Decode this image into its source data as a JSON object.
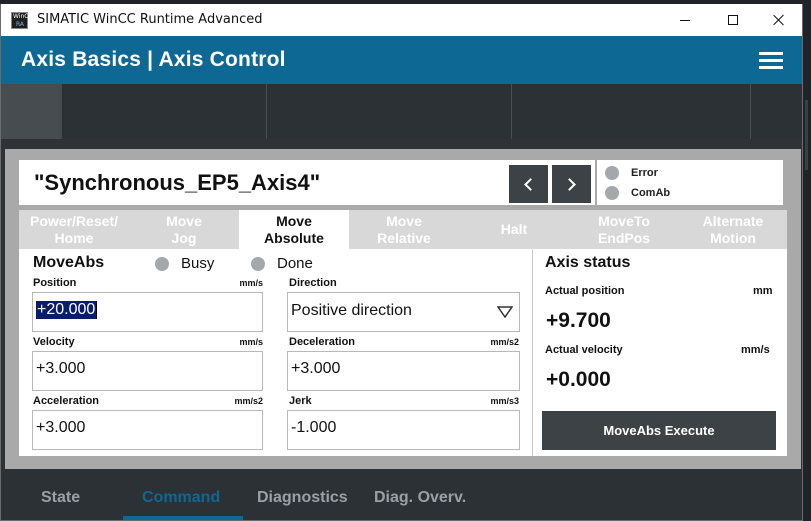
{
  "window": {
    "title": "SIMATIC WinCC Runtime Advanced",
    "icon_text_top": "WinCC",
    "icon_text_bottom": "RA"
  },
  "header": {
    "title": "Axis Basics | Axis Control"
  },
  "axis": {
    "name": "\"Synchronous_EP5_Axis4\""
  },
  "status": {
    "error_label": "Error",
    "comab_label": "ComAb",
    "led_color": "#a4a8ab"
  },
  "tabs": [
    {
      "label": "Power/Reset/\nHome",
      "active": false
    },
    {
      "label": "Move\nJog",
      "active": false
    },
    {
      "label": "Move\nAbsolute",
      "active": true
    },
    {
      "label": "Move\nRelative",
      "active": false
    },
    {
      "label": "Halt",
      "active": false
    },
    {
      "label": "MoveTo\nEndPos",
      "active": false
    },
    {
      "label": "Alternate\nMotion",
      "active": false
    }
  ],
  "moveabs": {
    "title": "MoveAbs",
    "busy_label": "Busy",
    "done_label": "Done",
    "position": {
      "label": "Position",
      "unit": "mm/s",
      "value": "+20.000"
    },
    "velocity": {
      "label": "Velocity",
      "unit": "mm/s",
      "value": "+3.000"
    },
    "acceleration": {
      "label": "Acceleration",
      "unit": "mm/s2",
      "value": "+3.000"
    },
    "direction": {
      "label": "Direction",
      "value": "Positive direction"
    },
    "deceleration": {
      "label": "Deceleration",
      "unit": "mm/s2",
      "value": "+3.000"
    },
    "jerk": {
      "label": "Jerk",
      "unit": "mm/s3",
      "value": "-1.000"
    }
  },
  "axis_status": {
    "title": "Axis status",
    "actual_position": {
      "label": "Actual position",
      "unit": "mm",
      "value": "+9.700"
    },
    "actual_velocity": {
      "label": "Actual velocity",
      "unit": "mm/s",
      "value": "+0.000"
    },
    "execute_label": "MoveAbs Execute"
  },
  "bottom_nav": [
    {
      "label": "State",
      "active": false
    },
    {
      "label": "Command",
      "active": true
    },
    {
      "label": "Diagnostics",
      "active": false
    },
    {
      "label": "Diag. Overv.",
      "active": false
    }
  ],
  "colors": {
    "accent": "#0e6894",
    "dark_button": "#3c4245",
    "panel": "#a9a9a9",
    "selection": "#0a1d6b"
  }
}
